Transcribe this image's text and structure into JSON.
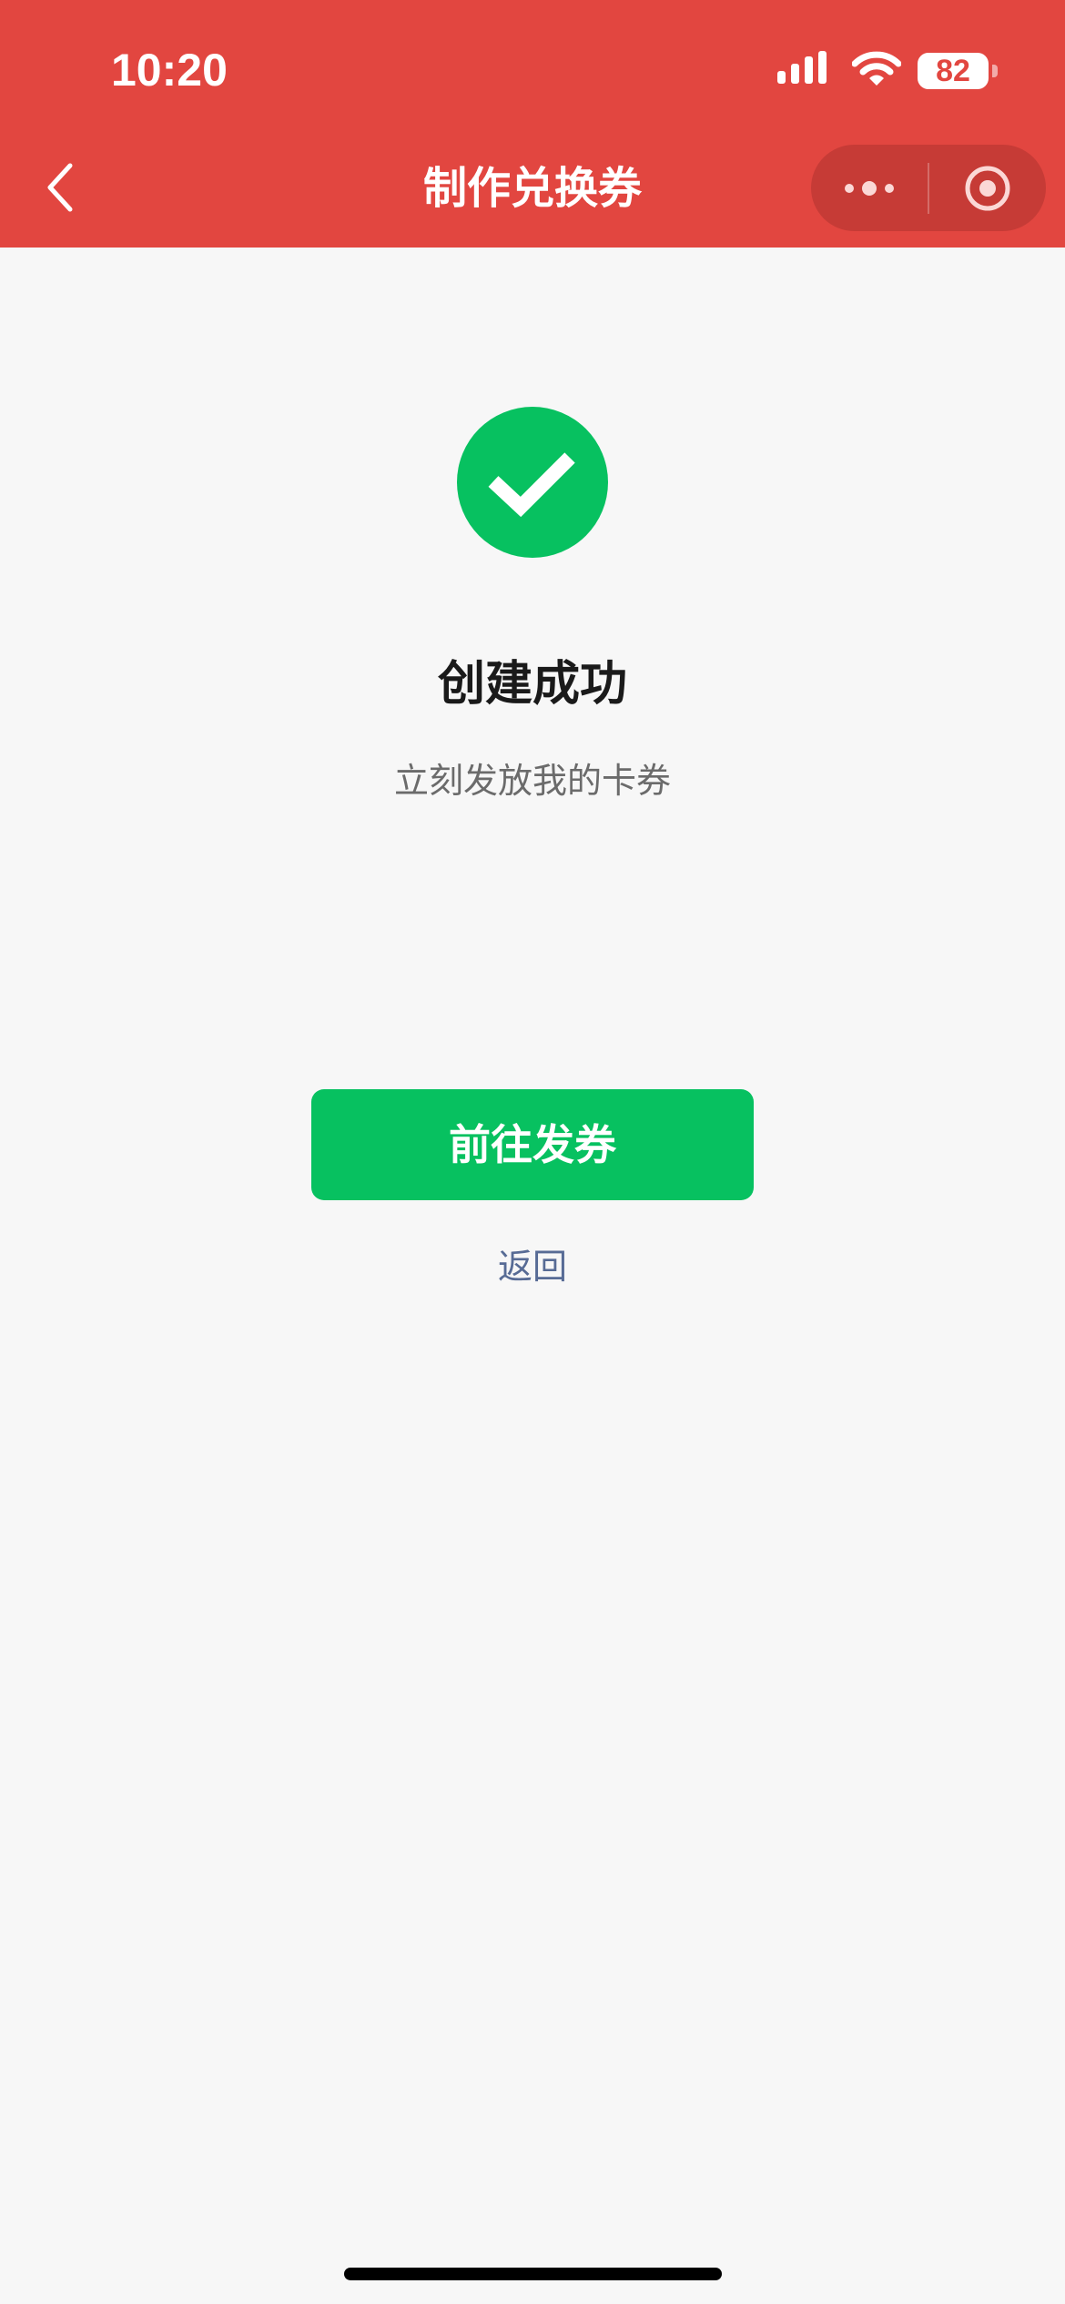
{
  "status_bar": {
    "time": "10:20",
    "battery_level": "82",
    "signal_icon": "cellular-signal-icon",
    "wifi_icon": "wifi-icon",
    "battery_icon": "battery-icon"
  },
  "nav_bar": {
    "title": "制作兑换券",
    "back_icon": "chevron-left-icon",
    "more_icon": "more-dots-icon",
    "close_icon": "target-close-icon"
  },
  "result": {
    "icon": "checkmark-circle-icon",
    "title": "创建成功",
    "subtitle": "立刻发放我的卡券",
    "primary_button_label": "前往发券",
    "back_link_label": "返回"
  },
  "colors": {
    "nav_background": "#e24640",
    "success_green": "#07c160",
    "link_blue": "#576b95",
    "page_background": "#f7f7f7"
  }
}
